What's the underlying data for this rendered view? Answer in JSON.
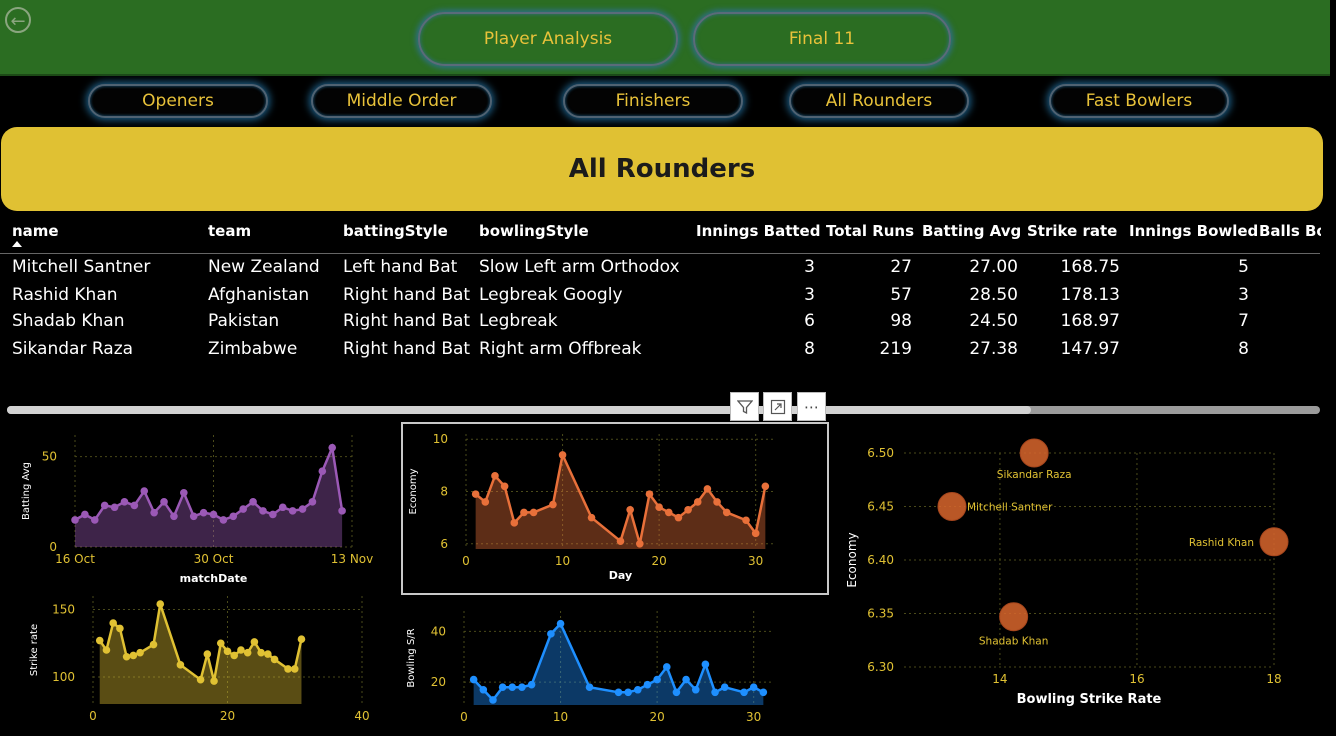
{
  "header": {
    "back_icon": "back-arrow-icon",
    "tabs": [
      "Player Analysis",
      "Final 11"
    ]
  },
  "roles": [
    "Openers",
    "Middle Order",
    "Finishers",
    "All Rounders",
    "Fast Bowlers"
  ],
  "banner": {
    "title": "All Rounders"
  },
  "table": {
    "columns": [
      "name",
      "team",
      "battingStyle",
      "bowlingStyle",
      "Innings Batted",
      "Total Runs",
      "Batting Avg",
      "Strike rate",
      "Innings Bowled",
      "Balls Bo"
    ],
    "sort_icon": "sort-ascending-icon",
    "rows": [
      [
        "Mitchell Santner",
        "New Zealand",
        "Left hand Bat",
        "Slow Left arm Orthodox",
        "3",
        "27",
        "27.00",
        "168.75",
        "5"
      ],
      [
        "Rashid Khan",
        "Afghanistan",
        "Right hand Bat",
        "Legbreak Googly",
        "3",
        "57",
        "28.50",
        "178.13",
        "3"
      ],
      [
        "Shadab Khan",
        "Pakistan",
        "Right hand Bat",
        "Legbreak",
        "6",
        "98",
        "24.50",
        "168.97",
        "7"
      ],
      [
        "Sikandar Raza",
        "Zimbabwe",
        "Right hand Bat",
        "Right arm Offbreak",
        "8",
        "219",
        "27.38",
        "147.97",
        "8"
      ]
    ],
    "toolbar_icons": [
      "filter-icon",
      "focus-mode-icon",
      "more-options-icon"
    ],
    "scroll_position": 0.78
  },
  "colors": {
    "banner": "#e0c133",
    "accent_text": "#e8c23a",
    "header_bg": "#2b6d22"
  },
  "chart_data": [
    {
      "type": "area",
      "xlabel": "matchDate",
      "ylabel": "Batting Avg",
      "x_tick_labels": [
        "16 Oct",
        "30 Oct",
        "13 Nov"
      ],
      "x_range": [
        16,
        44
      ],
      "ylim": [
        0,
        62
      ],
      "y_ticks": [
        0,
        50
      ],
      "color": "#9b59b6",
      "x": [
        16,
        17,
        18,
        19,
        20,
        21,
        22,
        23,
        24,
        25,
        26,
        27,
        28,
        29,
        30,
        31,
        32,
        33,
        34,
        35,
        36,
        37,
        38,
        39,
        40,
        41,
        42,
        43
      ],
      "values": [
        15,
        18,
        15,
        23,
        22,
        25,
        23,
        31,
        19,
        25,
        17,
        30,
        17,
        19,
        18,
        15,
        17,
        21,
        25,
        20,
        18,
        22,
        20,
        21,
        25,
        42,
        55,
        20
      ]
    },
    {
      "type": "area",
      "xlabel": "Day",
      "ylabel": "Economy",
      "xlim": [
        0,
        32
      ],
      "x_ticks": [
        0,
        10,
        20,
        30
      ],
      "ylim": [
        5.8,
        10.2
      ],
      "y_ticks": [
        6,
        8,
        10
      ],
      "color": "#e8703a",
      "x": [
        1,
        2,
        3,
        4,
        5,
        6,
        7,
        9,
        10,
        13,
        16,
        17,
        18,
        19,
        20,
        21,
        22,
        23,
        24,
        25,
        26,
        27,
        29,
        30,
        31
      ],
      "values": [
        7.9,
        7.6,
        8.6,
        8.2,
        6.8,
        7.2,
        7.2,
        7.5,
        9.4,
        7.0,
        6.1,
        7.3,
        6.0,
        7.9,
        7.4,
        7.2,
        7.0,
        7.3,
        7.6,
        8.1,
        7.6,
        7.2,
        6.9,
        6.4,
        8.2
      ]
    },
    {
      "type": "area",
      "xlabel": "",
      "ylabel": "Strike rate",
      "xlim": [
        0,
        40
      ],
      "x_ticks": [
        0,
        20,
        40
      ],
      "ylim": [
        80,
        160
      ],
      "y_ticks": [
        100,
        150
      ],
      "color": "#e0c133",
      "x": [
        1,
        2,
        3,
        4,
        5,
        6,
        7,
        9,
        10,
        13,
        16,
        17,
        18,
        19,
        20,
        21,
        22,
        23,
        24,
        25,
        26,
        27,
        29,
        30,
        31
      ],
      "values": [
        127,
        120,
        140,
        136,
        115,
        116,
        118,
        124,
        154,
        109,
        98,
        117,
        97,
        125,
        119,
        116,
        120,
        118,
        126,
        118,
        117,
        113,
        106,
        106,
        128
      ]
    },
    {
      "type": "area",
      "xlabel": "",
      "ylabel": "Bowling S/R",
      "xlim": [
        0,
        32
      ],
      "x_ticks": [
        0,
        10,
        20,
        30
      ],
      "ylim": [
        11,
        48
      ],
      "y_ticks": [
        20,
        40
      ],
      "color": "#1e8fff",
      "x": [
        1,
        2,
        3,
        4,
        5,
        6,
        7,
        9,
        10,
        13,
        16,
        17,
        18,
        19,
        20,
        21,
        22,
        23,
        24,
        25,
        26,
        27,
        29,
        30,
        31
      ],
      "values": [
        21,
        17,
        13,
        18,
        18,
        18,
        19,
        39,
        43,
        18,
        16,
        16,
        17,
        19,
        21,
        26,
        16,
        21,
        17,
        27,
        16,
        18,
        16,
        18,
        16
      ]
    },
    {
      "type": "scatter",
      "xlabel": "Bowling Strike Rate",
      "ylabel": "Economy",
      "xlim": [
        12.6,
        18
      ],
      "x_ticks": [
        14,
        16,
        18
      ],
      "ylim": [
        6.3,
        6.5
      ],
      "y_ticks": [
        "6.30",
        "6.35",
        "6.40",
        "6.45",
        "6.50"
      ],
      "color": "#d9662d",
      "points": [
        {
          "label": "Sikandar Raza",
          "x": 14.5,
          "y": 6.5
        },
        {
          "label": "Mitchell Santner",
          "x": 13.3,
          "y": 6.45
        },
        {
          "label": "Rashid Khan",
          "x": 18,
          "y": 6.417
        },
        {
          "label": "Shadab Khan",
          "x": 14.2,
          "y": 6.347
        }
      ]
    }
  ]
}
